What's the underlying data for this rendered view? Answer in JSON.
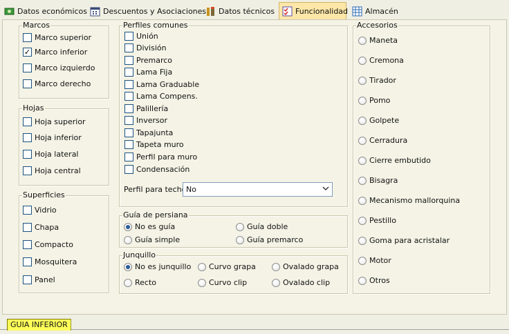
{
  "tabs": [
    {
      "label": "Datos económicos",
      "icon": "money-icon",
      "active": false
    },
    {
      "label": "Descuentos y Asociaciones",
      "icon": "calendar-icon",
      "active": false
    },
    {
      "label": "Datos técnicos",
      "icon": "tools-icon",
      "active": false
    },
    {
      "label": "Funcionalidad",
      "icon": "checklist-icon",
      "active": true
    },
    {
      "label": "Almacén",
      "icon": "grid-icon",
      "active": false
    }
  ],
  "marcos": {
    "title": "Marcos",
    "items": [
      {
        "label": "Marco superior",
        "checked": false
      },
      {
        "label": "Marco inferior",
        "checked": true
      },
      {
        "label": "Marco izquierdo",
        "checked": false
      },
      {
        "label": "Marco derecho",
        "checked": false
      }
    ]
  },
  "hojas": {
    "title": "Hojas",
    "items": [
      {
        "label": "Hoja superior",
        "checked": false
      },
      {
        "label": "Hoja inferior",
        "checked": false
      },
      {
        "label": "Hoja lateral",
        "checked": false
      },
      {
        "label": "Hoja central",
        "checked": false
      }
    ]
  },
  "superficies": {
    "title": "Superficies",
    "items": [
      {
        "label": "Vidrio",
        "checked": false
      },
      {
        "label": "Chapa",
        "checked": false
      },
      {
        "label": "Compacto",
        "checked": false
      },
      {
        "label": "Mosquitera",
        "checked": false
      },
      {
        "label": "Panel",
        "checked": false
      }
    ]
  },
  "perfiles": {
    "title": "Perfiles comunes",
    "items": [
      {
        "label": "Unión",
        "checked": false
      },
      {
        "label": "División",
        "checked": false
      },
      {
        "label": "Premarco",
        "checked": false
      },
      {
        "label": "Lama Fija",
        "checked": false
      },
      {
        "label": "Lama Graduable",
        "checked": false
      },
      {
        "label": "Lama Compens.",
        "checked": false
      },
      {
        "label": "Palillería",
        "checked": false
      },
      {
        "label": "Inversor",
        "checked": false
      },
      {
        "label": "Tapajunta",
        "checked": false
      },
      {
        "label": "Tapeta muro",
        "checked": false
      },
      {
        "label": "Perfil para muro",
        "checked": false
      },
      {
        "label": "Condensación",
        "checked": false
      }
    ],
    "techo_label": "Perfil para techo",
    "techo_value": "No"
  },
  "guia": {
    "title": "Guía de persiana",
    "options": [
      {
        "label": "No es guía",
        "selected": true
      },
      {
        "label": "Guía doble",
        "selected": false
      },
      {
        "label": "Guía simple",
        "selected": false
      },
      {
        "label": "Guía premarco",
        "selected": false
      }
    ]
  },
  "junquillo": {
    "title": "Junquillo",
    "options": [
      {
        "label": "No es junquillo",
        "selected": true
      },
      {
        "label": "Curvo grapa",
        "selected": false
      },
      {
        "label": "Ovalado grapa",
        "selected": false
      },
      {
        "label": "Recto",
        "selected": false
      },
      {
        "label": "Curvo clip",
        "selected": false
      },
      {
        "label": "Ovalado clip",
        "selected": false
      }
    ]
  },
  "accesorios": {
    "title": "Accesorios",
    "options": [
      {
        "label": "Maneta",
        "selected": false
      },
      {
        "label": "Cremona",
        "selected": false
      },
      {
        "label": "Tirador",
        "selected": false
      },
      {
        "label": "Pomo",
        "selected": false
      },
      {
        "label": "Golpete",
        "selected": false
      },
      {
        "label": "Cerradura",
        "selected": false
      },
      {
        "label": "Cierre embutido",
        "selected": false
      },
      {
        "label": "Bisagra",
        "selected": false
      },
      {
        "label": "Mecanismo mallorquina",
        "selected": false
      },
      {
        "label": "Pestillo",
        "selected": false
      },
      {
        "label": "Goma para acristalar",
        "selected": false
      },
      {
        "label": "Motor",
        "selected": false
      },
      {
        "label": "Otros",
        "selected": false
      }
    ]
  },
  "bottom_tab": {
    "label": "GUIA INFERIOR"
  },
  "colors": {
    "active_tab": "#fce7a8",
    "bottom_tab": "#ffff5a",
    "radio_dot": "#2a5a98"
  }
}
